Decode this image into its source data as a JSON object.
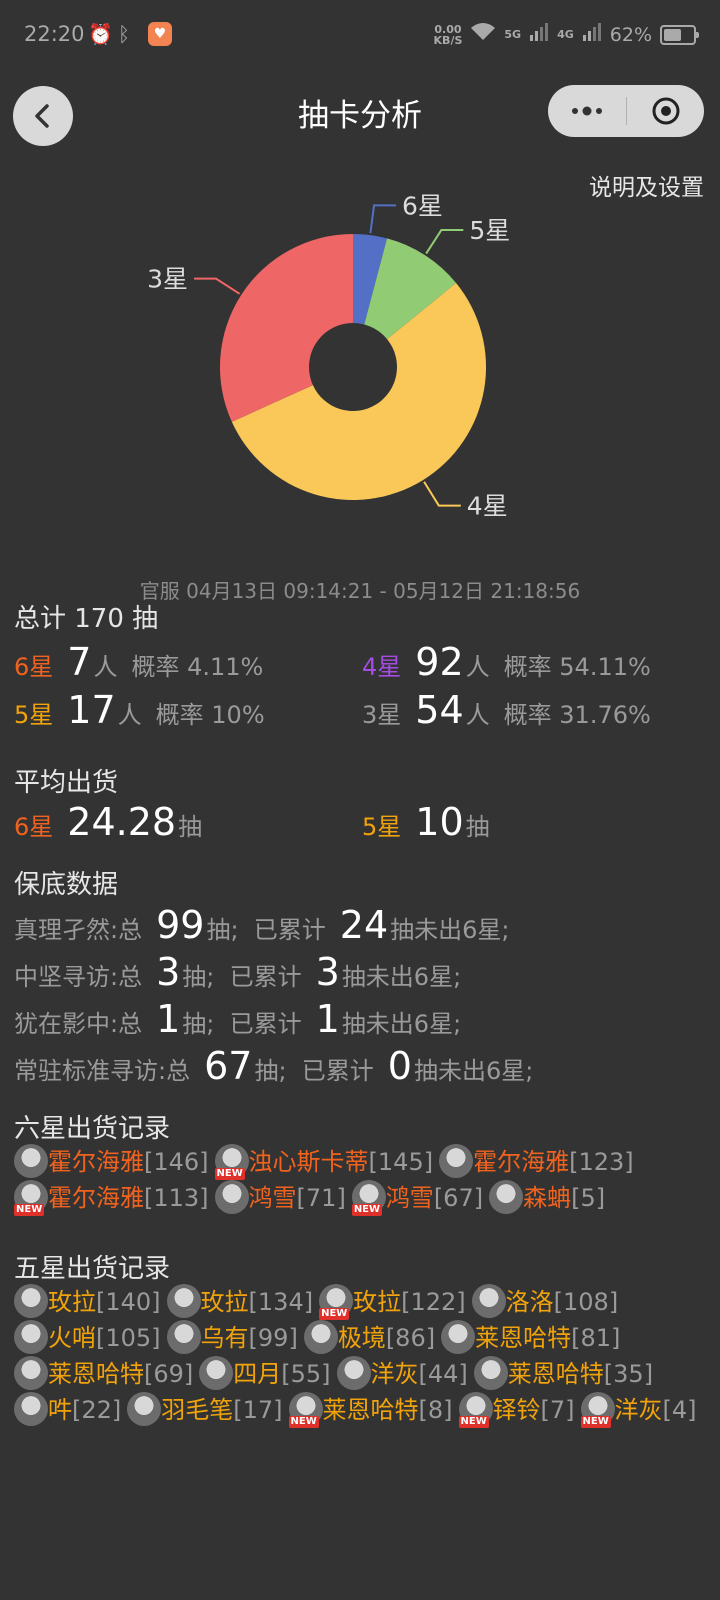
{
  "status_bar": {
    "time": "22:20",
    "net_speed_value": "0.00",
    "net_speed_unit": "KB/S",
    "signal1": "5G",
    "signal2": "4G",
    "battery": "62%",
    "battery_level": 0.62
  },
  "header": {
    "title": "抽卡分析",
    "settings_link": "说明及设置"
  },
  "chart_data": {
    "type": "pie",
    "style": "donut",
    "categories": [
      "6星",
      "5星",
      "4星",
      "3星"
    ],
    "values": [
      7,
      17,
      92,
      54
    ],
    "colors": [
      "#5470c6",
      "#91cc75",
      "#fac858",
      "#ee6666"
    ]
  },
  "date_range": "官服  04月13日 09:14:21  -  05月12日 21:18:56",
  "summary": {
    "total_label": "总计 170 抽",
    "stats": [
      {
        "star": "6星",
        "count": "7",
        "unit": "人",
        "rate_label": "概率",
        "rate": "4.11%",
        "color": "#f0631e"
      },
      {
        "star": "4星",
        "count": "92",
        "unit": "人",
        "rate_label": "概率",
        "rate": "54.11%",
        "color": "#a54ce6"
      },
      {
        "star": "5星",
        "count": "17",
        "unit": "人",
        "rate_label": "概率",
        "rate": "10%",
        "color": "#f0a30a"
      },
      {
        "star": "3星",
        "count": "54",
        "unit": "人",
        "rate_label": "概率",
        "rate": "31.76%",
        "color": "#9a9a9a"
      }
    ]
  },
  "average": {
    "title": "平均出货",
    "items": [
      {
        "star": "6星",
        "value": "24.28",
        "unit": "抽"
      },
      {
        "star": "5星",
        "value": "10",
        "unit": "抽"
      }
    ]
  },
  "pity": {
    "title": "保底数据",
    "rows": [
      {
        "pool": "真理孑然:总",
        "total": "99",
        "mid": "抽;  已累计",
        "current": "24",
        "tail": "抽未出6星;"
      },
      {
        "pool": "中坚寻访:总",
        "total": "3",
        "mid": "抽;  已累计",
        "current": "3",
        "tail": "抽未出6星;"
      },
      {
        "pool": "犹在影中:总",
        "total": "1",
        "mid": "抽;  已累计",
        "current": "1",
        "tail": "抽未出6星;"
      },
      {
        "pool": "常驻标准寻访:总",
        "total": "67",
        "mid": "抽;  已累计",
        "current": "0",
        "tail": "抽未出6星;"
      }
    ]
  },
  "six_star_records": {
    "title": "六星出货记录",
    "items": [
      {
        "name": "霍尔海雅",
        "pulls": "[146]",
        "new": false
      },
      {
        "name": "浊心斯卡蒂",
        "pulls": "[145]",
        "new": true
      },
      {
        "name": "霍尔海雅",
        "pulls": "[123]",
        "new": false
      },
      {
        "name": "霍尔海雅",
        "pulls": "[113]",
        "new": true
      },
      {
        "name": "鸿雪",
        "pulls": "[71]",
        "new": false
      },
      {
        "name": "鸿雪",
        "pulls": "[67]",
        "new": true
      },
      {
        "name": "森蚺",
        "pulls": "[5]",
        "new": false
      }
    ]
  },
  "five_star_records": {
    "title": "五星出货记录",
    "items": [
      {
        "name": "玫拉",
        "pulls": "[140]",
        "new": false
      },
      {
        "name": "玫拉",
        "pulls": "[134]",
        "new": false
      },
      {
        "name": "玫拉",
        "pulls": "[122]",
        "new": true
      },
      {
        "name": "洛洛",
        "pulls": "[108]",
        "new": false
      },
      {
        "name": "火哨",
        "pulls": "[105]",
        "new": false
      },
      {
        "name": "乌有",
        "pulls": "[99]",
        "new": false
      },
      {
        "name": "极境",
        "pulls": "[86]",
        "new": false
      },
      {
        "name": "莱恩哈特",
        "pulls": "[81]",
        "new": false
      },
      {
        "name": "莱恩哈特",
        "pulls": "[69]",
        "new": false
      },
      {
        "name": "四月",
        "pulls": "[55]",
        "new": false
      },
      {
        "name": "洋灰",
        "pulls": "[44]",
        "new": false
      },
      {
        "name": "莱恩哈特",
        "pulls": "[35]",
        "new": false
      },
      {
        "name": "吽",
        "pulls": "[22]",
        "new": false
      },
      {
        "name": "羽毛笔",
        "pulls": "[17]",
        "new": false
      },
      {
        "name": "莱恩哈特",
        "pulls": "[8]",
        "new": true
      },
      {
        "name": "铎铃",
        "pulls": "[7]",
        "new": true
      },
      {
        "name": "洋灰",
        "pulls": "[4]",
        "new": true
      }
    ]
  },
  "new_tag": "NEW"
}
